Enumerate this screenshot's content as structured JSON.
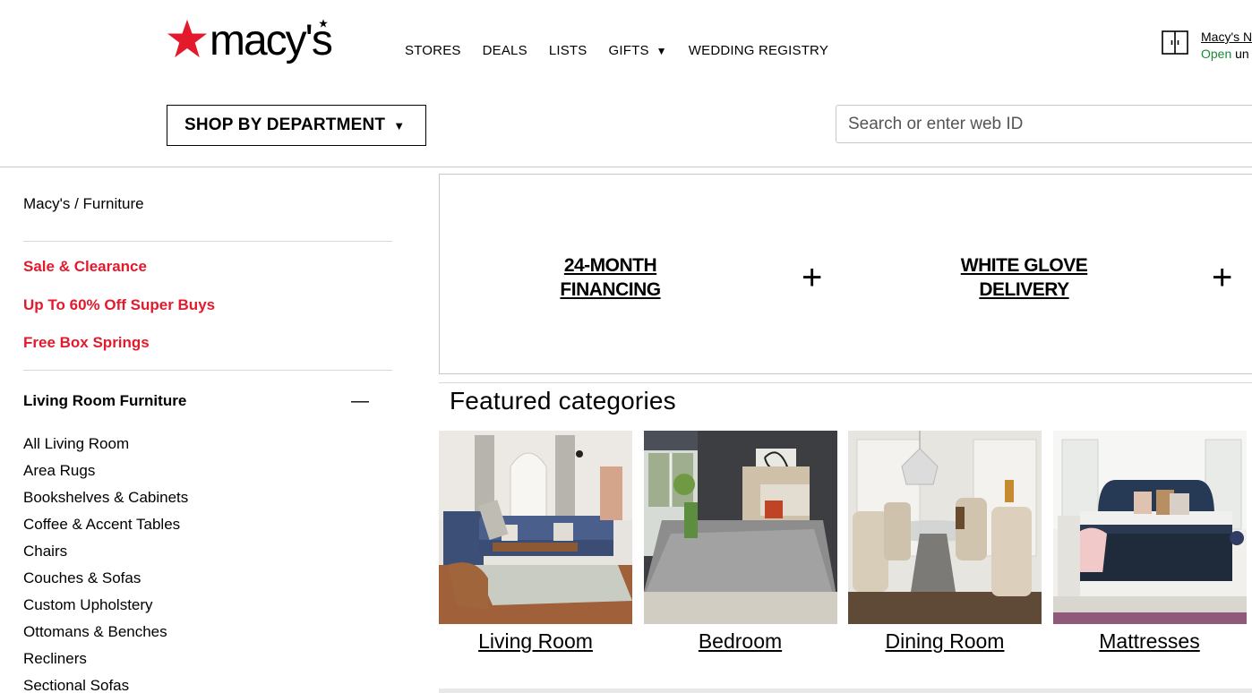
{
  "brand": {
    "name": "macy's"
  },
  "nav": {
    "items": [
      {
        "label": "STORES"
      },
      {
        "label": "DEALS"
      },
      {
        "label": "LISTS"
      },
      {
        "label": "GIFTS",
        "caret": "▼"
      },
      {
        "label": "WEDDING REGISTRY"
      }
    ]
  },
  "store": {
    "name": "Macy's N",
    "status": "Open",
    "hours": "un"
  },
  "shop_dept": {
    "label": "SHOP BY DEPARTMENT",
    "caret": "▼"
  },
  "search": {
    "placeholder": "Search or enter web ID"
  },
  "sidebar": {
    "breadcrumb": "Macy's / Furniture",
    "promos": [
      "Sale & Clearance",
      "Up To 60% Off Super Buys",
      "Free Box Springs"
    ],
    "category_title": "Living Room Furniture",
    "collapse_symbol": "—",
    "categories": [
      "All Living Room",
      "Area Rugs",
      "Bookshelves & Cabinets",
      "Coffee & Accent Tables",
      "Chairs",
      "Couches & Sofas",
      "Custom Upholstery",
      "Ottomans & Benches",
      "Recliners",
      "Sectional Sofas"
    ]
  },
  "banner": {
    "item1_line1": "24-MONTH",
    "item1_line2": "FINANCING",
    "item2_line1": "WHITE GLOVE",
    "item2_line2": "DELIVERY",
    "plus": "+"
  },
  "featured": {
    "title": "Featured categories",
    "tiles": [
      {
        "label": "Living Room"
      },
      {
        "label": "Bedroom"
      },
      {
        "label": "Dining Room"
      },
      {
        "label": "Mattresses"
      }
    ]
  },
  "colors": {
    "accent": "#e21a2c",
    "open": "#1a8a3a"
  }
}
